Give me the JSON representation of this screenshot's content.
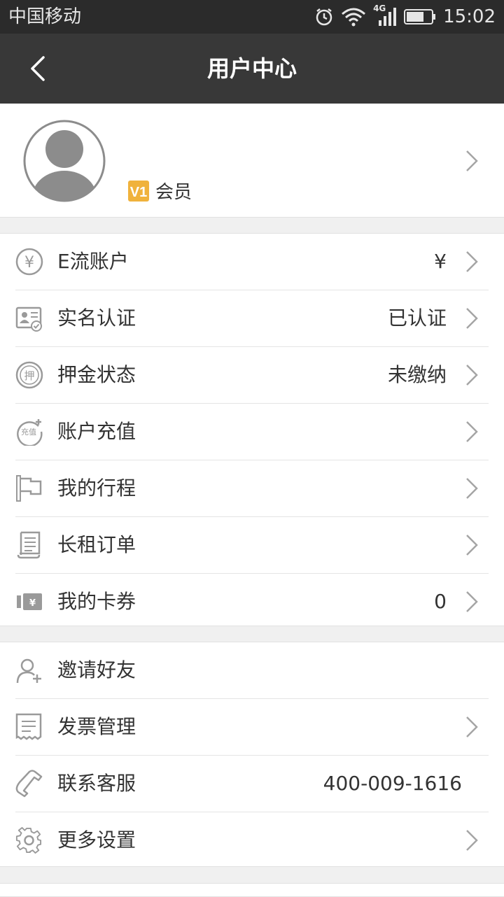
{
  "status": {
    "carrier": "中国移动",
    "network": "4G",
    "time": "15:02"
  },
  "header": {
    "title": "用户中心"
  },
  "profile": {
    "member_label": "会员",
    "badge_text": "V1"
  },
  "section1": [
    {
      "label": "E流账户",
      "value": "¥"
    },
    {
      "label": "实名认证",
      "value": "已认证"
    },
    {
      "label": "押金状态",
      "value": "未缴纳"
    },
    {
      "label": "账户充值",
      "value": ""
    },
    {
      "label": "我的行程",
      "value": ""
    },
    {
      "label": "长租订单",
      "value": ""
    },
    {
      "label": "我的卡券",
      "value": "0"
    }
  ],
  "section2": [
    {
      "label": "邀请好友",
      "value": ""
    },
    {
      "label": "发票管理",
      "value": ""
    },
    {
      "label": "联系客服",
      "value": "400-009-1616"
    },
    {
      "label": "更多设置",
      "value": ""
    }
  ],
  "icons": {
    "yuan_glyph": "¥",
    "deposit_glyph": "押",
    "recharge_glyph": "充值"
  },
  "colors": {
    "nav_bg": "#383838",
    "status_bg": "#2b2b2b",
    "badge": "#f0b23c",
    "icon_gray": "#9a9a9a"
  }
}
